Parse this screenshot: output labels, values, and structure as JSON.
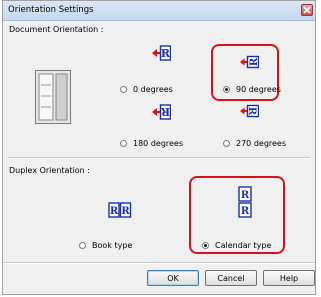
{
  "window": {
    "title": "Orientation Settings",
    "close_icon": "close-icon"
  },
  "document_orientation": {
    "label": "Document Orientation :",
    "options": [
      {
        "label": "0 degrees",
        "checked": false,
        "icon": "orientation-0-icon"
      },
      {
        "label": "90 degrees",
        "checked": true,
        "icon": "orientation-90-icon"
      },
      {
        "label": "180 degrees",
        "checked": false,
        "icon": "orientation-180-icon"
      },
      {
        "label": "270 degrees",
        "checked": false,
        "icon": "orientation-270-icon"
      }
    ],
    "glyph": "R"
  },
  "duplex_orientation": {
    "label": "Duplex Orientation :",
    "options": [
      {
        "label": "Book type",
        "checked": false,
        "icon": "book-type-icon"
      },
      {
        "label": "Calendar type",
        "checked": true,
        "icon": "calendar-type-icon"
      }
    ]
  },
  "buttons": {
    "ok": "OK",
    "cancel": "Cancel",
    "help": "Help"
  },
  "colors": {
    "highlight": "#d8121a",
    "icon_blue": "#1a2fa6",
    "arrow_red": "#e01010"
  }
}
